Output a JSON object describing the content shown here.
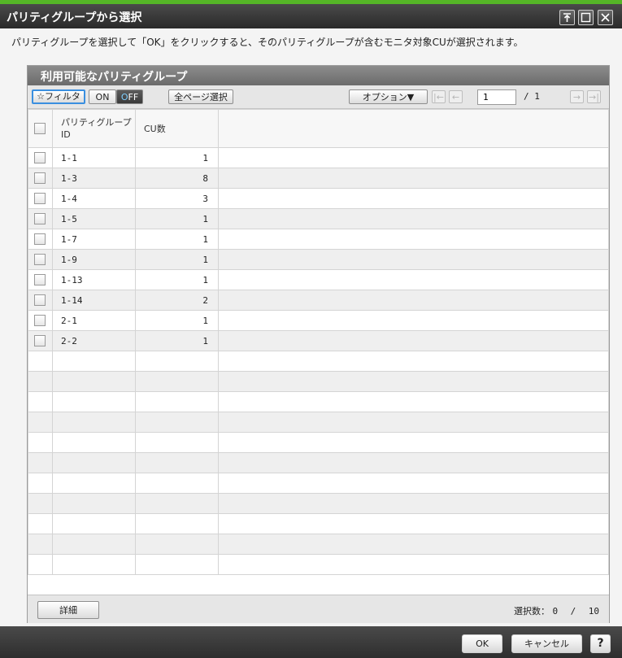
{
  "window": {
    "title": "パリティグループから選択",
    "description": "パリティグループを選択して「OK」をクリックすると、そのパリティグループが含むモニタ対象CUが選択されます。",
    "controls": [
      "pin-icon",
      "maximize-icon",
      "close-icon"
    ]
  },
  "panel": {
    "title": "利用可能なパリティグループ",
    "toolbar": {
      "filter_label": "☆フィルタ",
      "on_label": "ON",
      "off_label_o": "O",
      "off_label_rest": "FF",
      "select_all_pages_label": "全ページ選択",
      "options_label": "オプション▼",
      "current_page": "1",
      "total_pages": "/ 1",
      "nav_icons": [
        "first-page-icon",
        "prev-page-icon",
        "next-page-icon",
        "last-page-icon"
      ]
    },
    "table": {
      "headers": {
        "id": "パリティグループID",
        "cu": "CU数"
      },
      "rows": [
        {
          "id": "1-1",
          "cu": "1"
        },
        {
          "id": "1-3",
          "cu": "8"
        },
        {
          "id": "1-4",
          "cu": "3"
        },
        {
          "id": "1-5",
          "cu": "1"
        },
        {
          "id": "1-7",
          "cu": "1"
        },
        {
          "id": "1-9",
          "cu": "1"
        },
        {
          "id": "1-13",
          "cu": "1"
        },
        {
          "id": "1-14",
          "cu": "2"
        },
        {
          "id": "2-1",
          "cu": "1"
        },
        {
          "id": "2-2",
          "cu": "1"
        }
      ]
    },
    "footer": {
      "detail_label": "詳細",
      "selected_label": "選択数：",
      "selected_count": "0",
      "separator": "/",
      "total_count": "10"
    }
  },
  "buttons": {
    "ok": "OK",
    "cancel": "キャンセル",
    "help": "?"
  },
  "colors": {
    "accent_green": "#55b527",
    "focus_blue": "#3a8fe0",
    "title_bg": "#333333"
  }
}
